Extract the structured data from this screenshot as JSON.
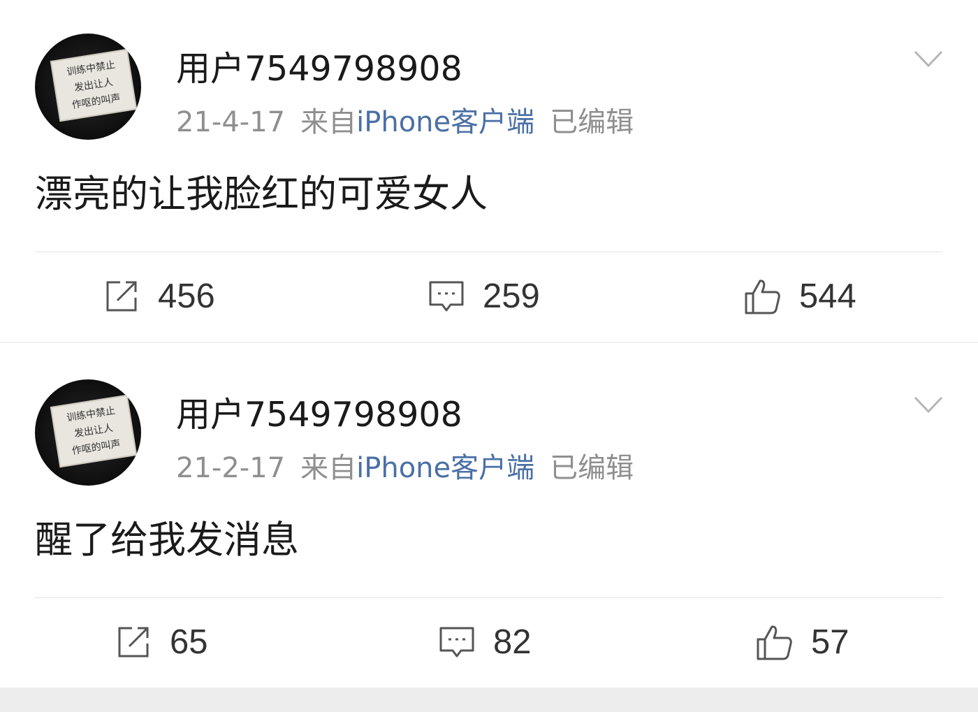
{
  "posts": [
    {
      "username": "用户7549798908",
      "date": "21-4-17",
      "source_prefix": "来自",
      "source": "iPhone客户端",
      "edited": "已编辑",
      "content": "漂亮的让我脸红的可爱女人",
      "reposts": "456",
      "comments": "259",
      "likes": "544"
    },
    {
      "username": "用户7549798908",
      "date": "21-2-17",
      "source_prefix": "来自",
      "source": "iPhone客户端",
      "edited": "已编辑",
      "content": "醒了给我发消息",
      "reposts": "65",
      "comments": "82",
      "likes": "57"
    }
  ],
  "avatar_sign_lines": [
    "训练中禁止",
    "发出让人",
    "作呕的叫声"
  ],
  "icons": {
    "repost": "share-out-icon",
    "comment": "comment-bubble-icon",
    "like": "thumbs-up-icon",
    "more": "chevron-down-icon"
  },
  "colors": {
    "source_link": "#4a6fa5",
    "meta_text": "#8f8f8f",
    "text": "#1a1a1a",
    "divider": "#e3e3e3"
  }
}
